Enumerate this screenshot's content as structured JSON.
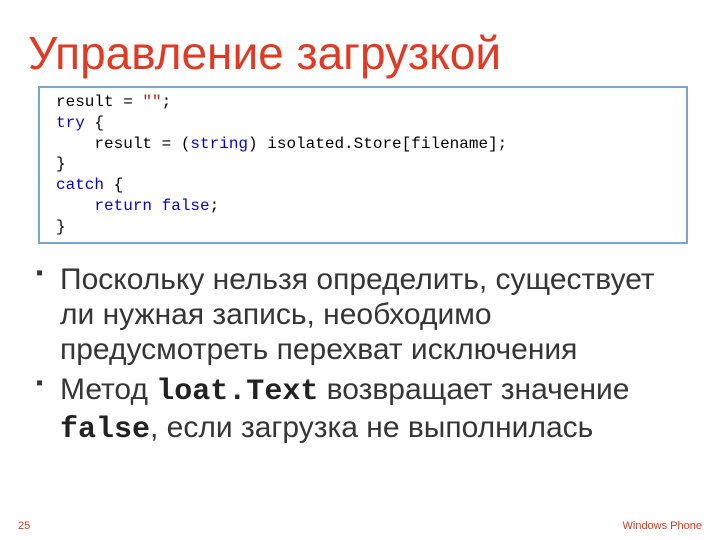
{
  "title": "Управление загрузкой",
  "code": {
    "l1a": "result = ",
    "l1b": "\"\"",
    "l1c": ";",
    "l2a": "try",
    "l2b": " {",
    "l3a": "    result = (",
    "l3b": "string",
    "l3c": ") isolated.Store[filename];",
    "l4": "}",
    "l5a": "catch",
    "l5b": "  {",
    "l6a": "    ",
    "l6b": "return",
    "l6c": " ",
    "l6d": "false",
    "l6e": ";",
    "l7": "}"
  },
  "bullets": {
    "b1": "Поскольку нельзя определить, существует ли нужная запись, необходимо предусмотреть перехват исключения",
    "b2_pre": "Метод ",
    "b2_code1": "loat.Text",
    "b2_mid": " возвращает значение ",
    "b2_code2": "false",
    "b2_post": ", если загрузка не выполнилась"
  },
  "footer": {
    "page": "25",
    "brand": "Windows Phone"
  }
}
